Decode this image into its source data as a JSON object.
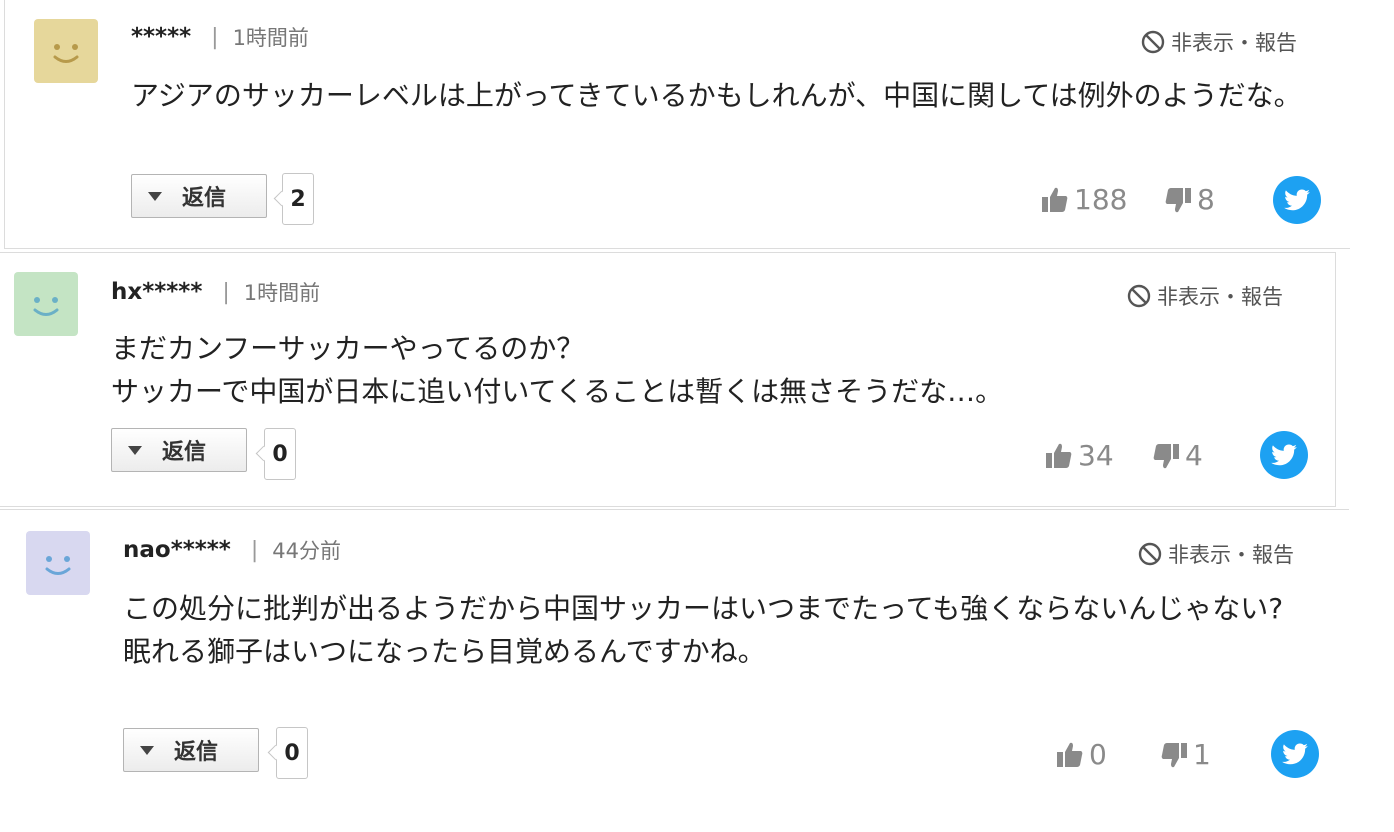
{
  "comments": [
    {
      "username": "*****",
      "separator": "|",
      "time": "1時間前",
      "hide_report": "非表示・報告",
      "text": "アジアのサッカーレベルは上がってきているかもしれんが、中国に関しては例外のようだな。",
      "reply_label": "返信",
      "reply_count": "2",
      "likes": "188",
      "dislikes": "8",
      "avatar_color": "#e6d79b",
      "avatar_face_color": "#b79a4b"
    },
    {
      "username": "hx*****",
      "separator": "|",
      "time": "1時間前",
      "hide_report": "非表示・報告",
      "text": "まだカンフーサッカーやってるのか？\nサッカーで中国が日本に追い付いてくることは暫くは無さそうだな…。",
      "reply_label": "返信",
      "reply_count": "0",
      "likes": "34",
      "dislikes": "4",
      "avatar_color": "#c4e4c4",
      "avatar_face_color": "#6bb0c6"
    },
    {
      "username": "nao*****",
      "separator": "|",
      "time": "44分前",
      "hide_report": "非表示・報告",
      "text": "この処分に批判が出るようだから中国サッカーはいつまでたっても強くならないんじゃない?\n眠れる獅子はいつになったら目覚めるんですかね。",
      "reply_label": "返信",
      "reply_count": "0",
      "likes": "0",
      "dislikes": "1",
      "avatar_color": "#d8d8f0",
      "avatar_face_color": "#6aa6d8"
    }
  ],
  "icons": {
    "hide": "no-entry-icon",
    "like": "thumbs-up-icon",
    "dislike": "thumbs-down-icon",
    "share": "twitter-icon",
    "reply_toggle": "triangle-down-icon"
  },
  "colors": {
    "twitter": "#1da1f2",
    "vote_gray": "#8a8a8a"
  }
}
